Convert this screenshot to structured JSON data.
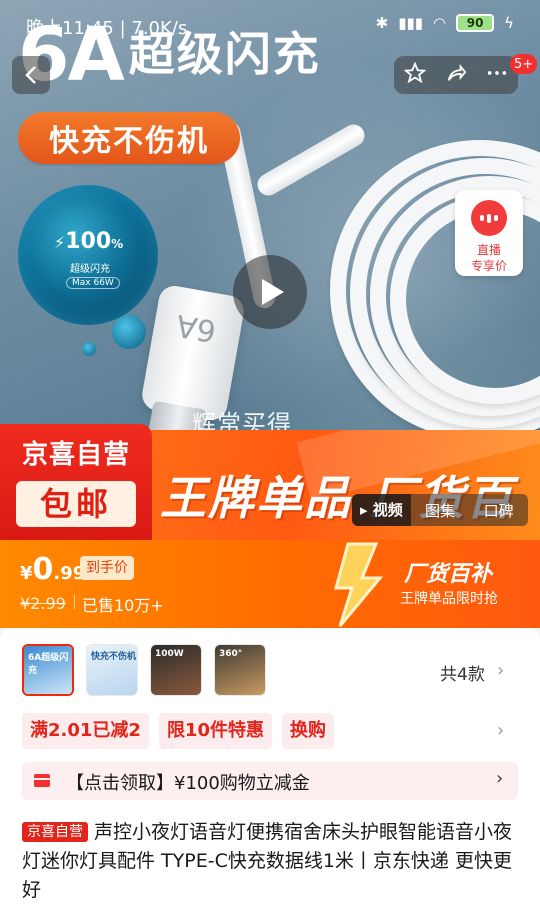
{
  "status_bar": {
    "time": "晚上11:45 | 7.0K/s",
    "battery": "90"
  },
  "hero": {
    "big_title_num": "6A",
    "big_title_text": "超级闪充",
    "promo_pill": "快充不伤机",
    "bubble_percent": "100",
    "bubble_percent_unit": "%",
    "bubble_sub": "超级闪充",
    "bubble_max": "Max 66W",
    "connector_label": "6A",
    "watermark": "辉常买得",
    "live_label_1": "直播",
    "live_label_2": "专享价",
    "top_badge": "5+"
  },
  "banner": {
    "self_label": "京喜自营",
    "free_ship": "包邮",
    "title": "王牌单品 厂货百补",
    "media_tabs": [
      "视频",
      "图集",
      "口碑"
    ]
  },
  "price": {
    "symbol": "¥",
    "integer": "0",
    "decimal": ".99",
    "hand_price_label": "到手价",
    "original": "¥2.99",
    "sold": "已售10万+",
    "tag_title": "厂货百补",
    "tag_sub": "王牌单品限时抢"
  },
  "variants": {
    "count_label": "共4款",
    "thumbs": [
      {
        "label": "6A超级闪充",
        "color": "#2a7fc4"
      },
      {
        "label": "快充不伤机",
        "color": "#cfe3f2"
      },
      {
        "label": "100W",
        "color": "#6b4b3e"
      },
      {
        "label": "360°",
        "color": "#6a5a48"
      }
    ]
  },
  "coupons": [
    "满2.01已减2",
    "限10件特惠",
    "换购"
  ],
  "claim_text": "【点击领取】¥100购物立减金",
  "product": {
    "tag": "京喜自营",
    "title": "声控小夜灯语音灯便携宿舍床头护眼智能语音小夜灯迷你灯具配件 TYPE-C快充数据线1米丨京东快递 更快更好"
  },
  "colors": {
    "brand_red": "#e1251b",
    "orange": "#ff6a00"
  }
}
